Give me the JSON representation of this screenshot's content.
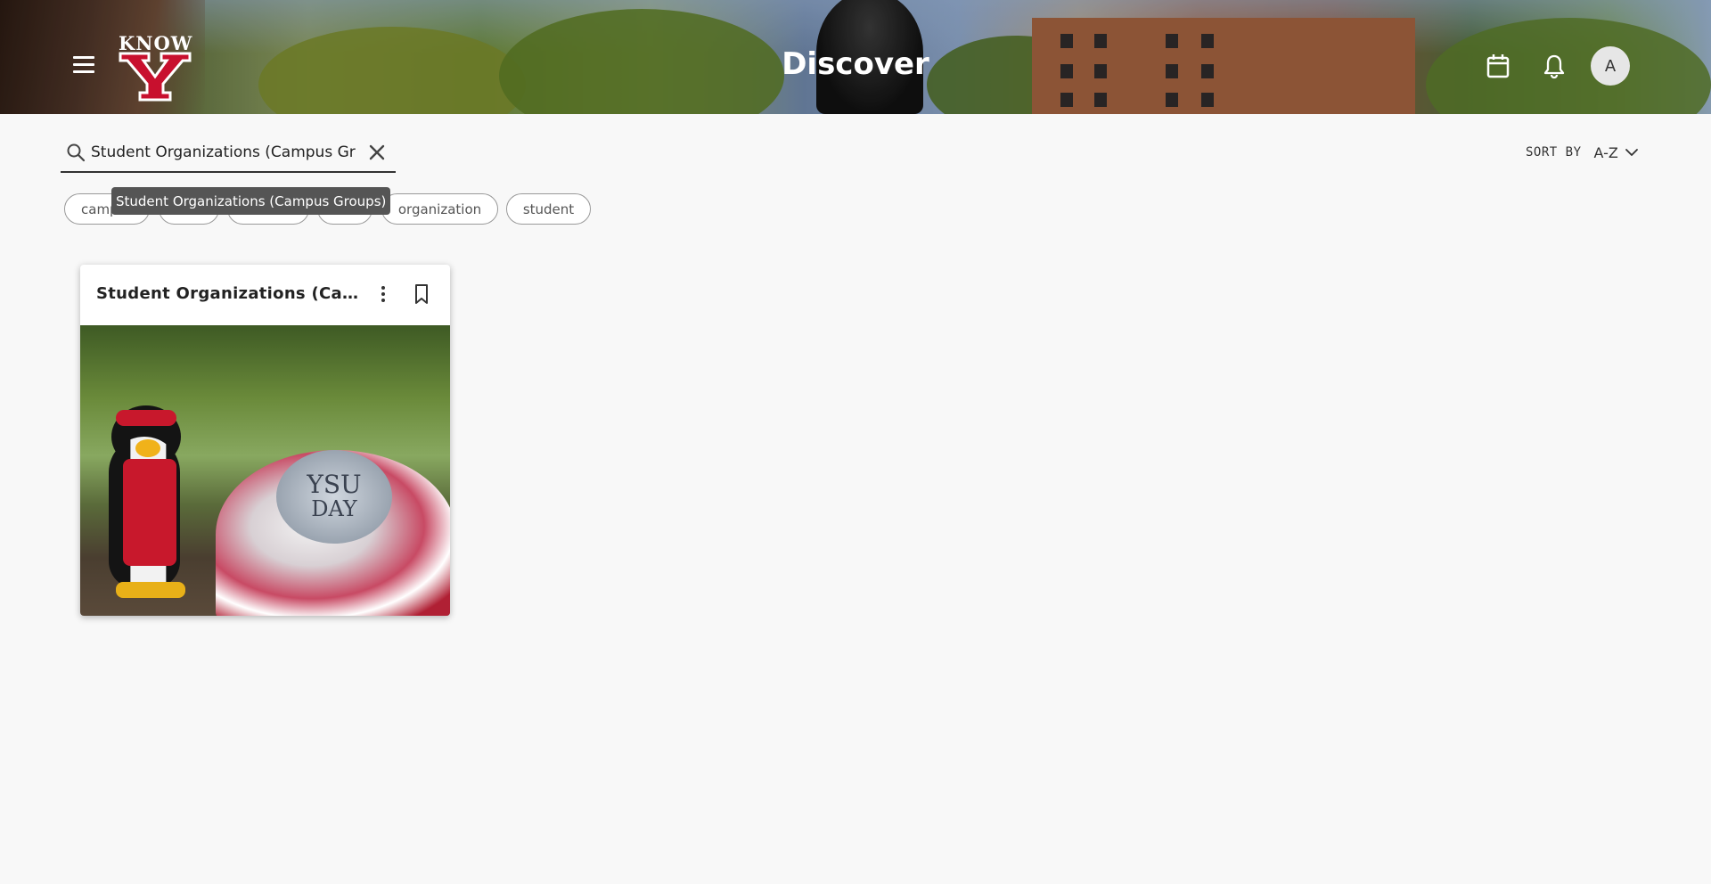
{
  "header": {
    "logo_text": "KNOW",
    "logo_letter": "Y",
    "title": "Discover",
    "avatar_initial": "A"
  },
  "search": {
    "value": "Student Organizations (Campus Gr",
    "tooltip": "Student Organizations (Campus Groups)"
  },
  "sort": {
    "label": "SORT BY",
    "value": "A-Z"
  },
  "chips": [
    {
      "label": "camp"
    },
    {
      "label": ""
    },
    {
      "label": ""
    },
    {
      "label": ""
    },
    {
      "label": "organization"
    },
    {
      "label": "student"
    }
  ],
  "card": {
    "title": "Student Organizations (Campus Groups)",
    "image_text_1": "YSU",
    "image_text_2": "DAY"
  },
  "colors": {
    "brand_red": "#c8102e",
    "background": "#f8f8f8"
  },
  "icons": [
    "menu-icon",
    "search-icon",
    "close-icon",
    "chevron-down-icon",
    "calendar-icon",
    "bell-icon",
    "more-vertical-icon",
    "bookmark-icon"
  ]
}
